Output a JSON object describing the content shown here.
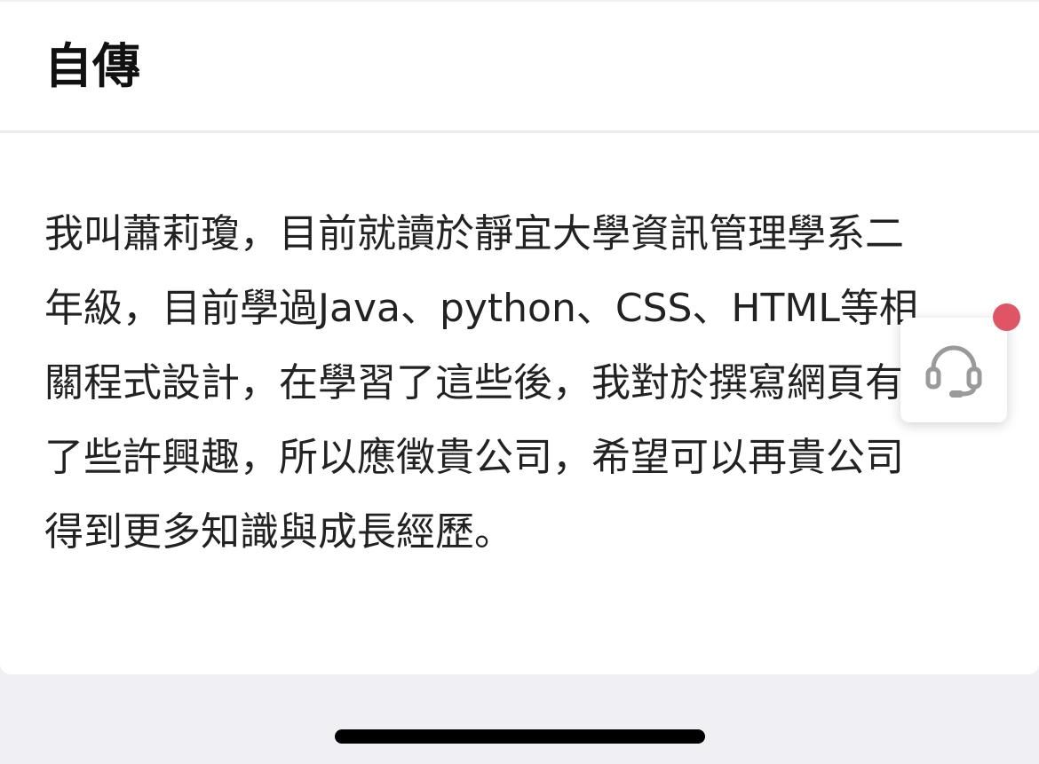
{
  "section": {
    "title": "自傳"
  },
  "autobiography": {
    "lines": [
      "我叫蕭莉瓊，目前就讀於靜宜大學資訊管理學系二",
      "年級，目前學過Java、python、CSS、HTML等相",
      "關程式設計，在學習了這些後，我對於撰寫網頁有",
      "了些許興趣，所以應徵貴公司，希望可以再貴公司",
      "得到更多知識與成長經歷。"
    ]
  },
  "support_widget": {
    "icon": "headset-icon",
    "has_notification": true
  },
  "colors": {
    "notification": "#e05565",
    "icon_gray": "#9a9a9a",
    "background": "#efeff4"
  }
}
